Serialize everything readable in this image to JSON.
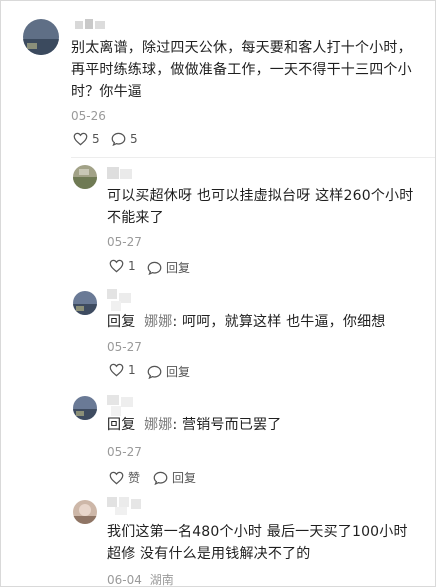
{
  "main_comment": {
    "text_lines": [
      "别太离谱，除过四天公休，每天要和客人打十个小时，",
      "再平时练练球，做做准备工作，一天不得干十三四个小",
      "时？你牛逼"
    ],
    "date": "05-26",
    "likes": "5",
    "replies": "5"
  },
  "replies": [
    {
      "text_lines": [
        "可以买超休呀 也可以挂虚拟台呀 这样260个小时",
        "不能来了"
      ],
      "date": "05-27",
      "likes": "1",
      "reply_label": "回复"
    },
    {
      "prefix": "回复",
      "reply_to": "娜娜",
      "text": ": 呵呵，就算这样 也牛逼，你细想",
      "date": "05-27",
      "likes": "1",
      "reply_label": "回复"
    },
    {
      "prefix": "回复",
      "reply_to": "娜娜",
      "text": ": 营销号而已罢了",
      "date": "05-27",
      "likes": "赞",
      "reply_label": "回复"
    },
    {
      "text_lines": [
        "我们这第一名480个小时 最后一天买了100小时",
        "超修 没有什么是用钱解决不了的"
      ],
      "date": "06-04",
      "location": "湖南"
    }
  ],
  "icons": {
    "like": "heart-outline-icon",
    "comment": "comment-bubble-icon"
  }
}
